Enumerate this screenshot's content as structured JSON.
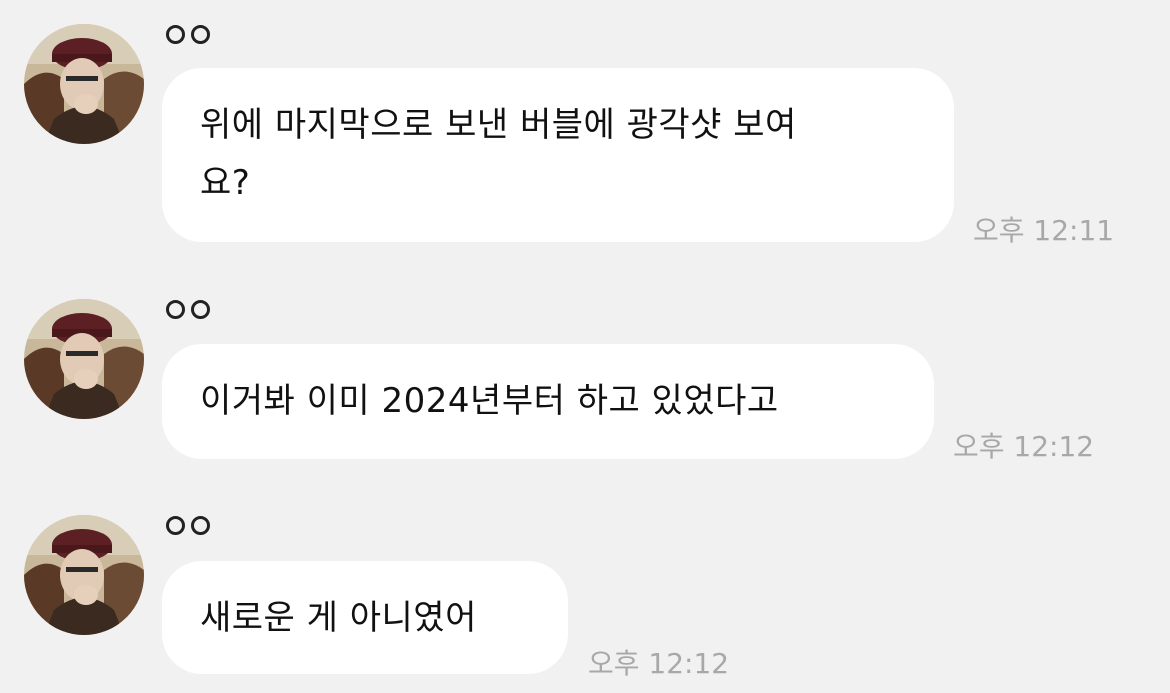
{
  "messages": [
    {
      "sender": "ㅇㅇ",
      "lines": [
        "위에 마지막으로 보낸 버블에 광각샷 보여",
        "요?"
      ],
      "time": "오후 12:11"
    },
    {
      "sender": "ㅇㅇ",
      "lines": [
        "이거봐 이미 2024년부터 하고 있었다고"
      ],
      "time": "오후 12:12"
    },
    {
      "sender": "ㅇㅇ",
      "lines": [
        "새로운 게 아니였어"
      ],
      "time": "오후 12:12"
    }
  ],
  "colors": {
    "background": "#f1f1f1",
    "bubble": "#ffffff",
    "text": "#111111",
    "timestamp": "#a8a8a8"
  },
  "icons": {
    "avatar": "profile-photo-avatar"
  }
}
